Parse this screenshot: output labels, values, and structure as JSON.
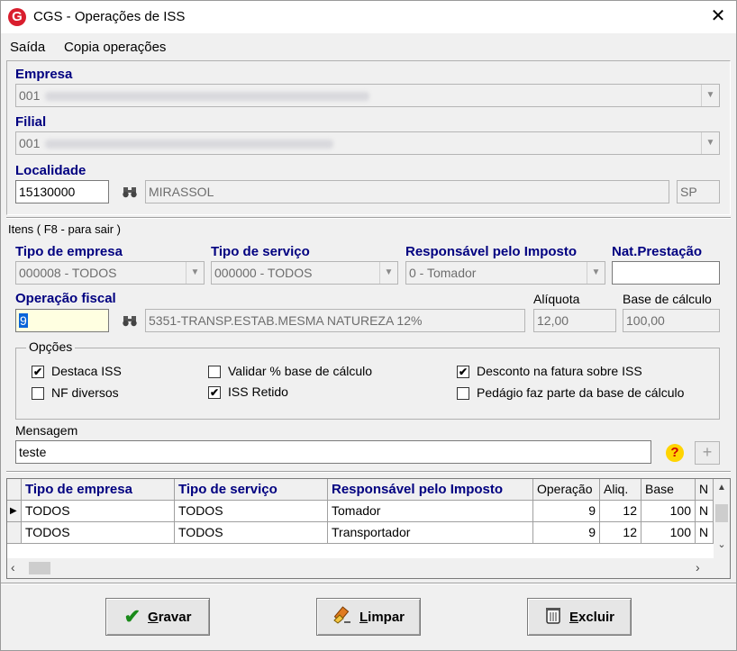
{
  "window": {
    "title": "CGS - Operações de ISS",
    "icon_letter": "G"
  },
  "menu": {
    "items": [
      "Saída",
      "Copia operações"
    ]
  },
  "empresa": {
    "label": "Empresa",
    "value": "001"
  },
  "filial": {
    "label": "Filial",
    "value": "001"
  },
  "localidade": {
    "label": "Localidade",
    "code": "15130000",
    "city": "MIRASSOL",
    "uf": "SP"
  },
  "itens": {
    "caption": "Itens ( F8 - para sair )"
  },
  "tipo_empresa": {
    "label": "Tipo de empresa",
    "value": "000008 - TODOS"
  },
  "tipo_servico": {
    "label": "Tipo de serviço",
    "value": "000000 - TODOS"
  },
  "responsavel": {
    "label": "Responsável pelo Imposto",
    "value": "0 - Tomador"
  },
  "nat_prestacao": {
    "label": "Nat.Prestação",
    "value": ""
  },
  "operacao_fiscal": {
    "label": "Operação fiscal",
    "code": "9",
    "description": "5351-TRANSP.ESTAB.MESMA NATUREZA 12%"
  },
  "aliquota": {
    "label": "Alíquota",
    "value": "12,00"
  },
  "base_calculo": {
    "label": "Base de cálculo",
    "value": "100,00"
  },
  "opcoes": {
    "title": "Opções",
    "destaca_iss": {
      "label": "Destaca ISS",
      "checked": true
    },
    "nf_diversos": {
      "label": "NF diversos",
      "checked": false
    },
    "validar_base": {
      "label": "Validar % base de cálculo",
      "checked": false
    },
    "iss_retido": {
      "label": "ISS Retido",
      "checked": true
    },
    "desconto_fatura": {
      "label": "Desconto na fatura sobre ISS",
      "checked": true
    },
    "pedagio": {
      "label": "Pedágio faz parte da base de cálculo",
      "checked": false
    }
  },
  "mensagem": {
    "label": "Mensagem",
    "value": "teste"
  },
  "grid": {
    "headers": [
      "Tipo de empresa",
      "Tipo de serviço",
      "Responsável pelo Imposto",
      "Operação",
      "Aliq.",
      "Base",
      "N"
    ],
    "rows": [
      [
        "TODOS",
        "TODOS",
        "Tomador",
        "9",
        "12",
        "100",
        "N"
      ],
      [
        "TODOS",
        "TODOS",
        "Transportador",
        "9",
        "12",
        "100",
        "N"
      ]
    ]
  },
  "buttons": {
    "gravar": {
      "accel": "G",
      "rest": "ravar"
    },
    "limpar": {
      "accel": "L",
      "rest": "impar"
    },
    "excluir": {
      "accel": "E",
      "rest": "xcluir"
    }
  },
  "colors": {
    "label_blue": "#000080",
    "brand_red": "#d91e2e",
    "highlight_yellow": "#ffffe1"
  }
}
